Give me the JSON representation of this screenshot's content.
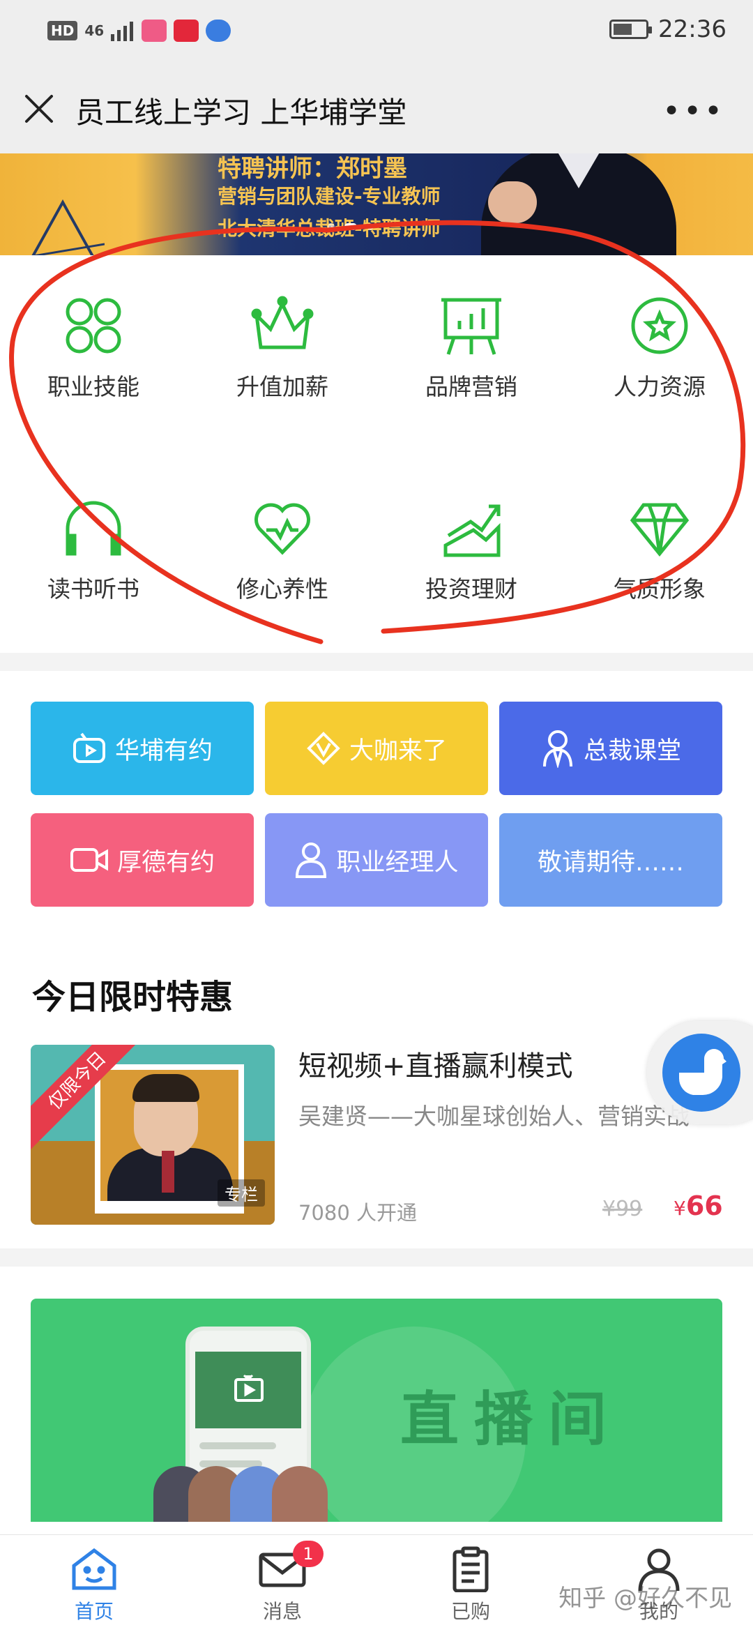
{
  "status_bar": {
    "hd": "HD",
    "signal": "46",
    "time": "22:36"
  },
  "title_bar": {
    "title": "员工线上学习 上华埔学堂",
    "more": "•••"
  },
  "banner": {
    "line1": "特聘讲师：郑时墨",
    "line2": "营销与团队建设-专业教师",
    "line3": "北大清华总裁班-特聘讲师"
  },
  "categories": [
    {
      "label": "职业技能",
      "icon": "clover-icon"
    },
    {
      "label": "升值加薪",
      "icon": "crown-icon"
    },
    {
      "label": "品牌营销",
      "icon": "billboard-chart-icon"
    },
    {
      "label": "人力资源",
      "icon": "star-circle-icon"
    },
    {
      "label": "读书听书",
      "icon": "headphones-icon"
    },
    {
      "label": "修心养性",
      "icon": "heart-pulse-icon"
    },
    {
      "label": "投资理财",
      "icon": "trend-chart-icon"
    },
    {
      "label": "气质形象",
      "icon": "diamond-icon"
    }
  ],
  "sections": [
    {
      "label": "华埔有约",
      "icon": "tv-play-icon",
      "color": "#2bb6ea"
    },
    {
      "label": "大咖来了",
      "icon": "v-badge-icon",
      "color": "#f6cc32"
    },
    {
      "label": "总裁课堂",
      "icon": "person-icon",
      "color": "#4b6ae8"
    },
    {
      "label": "厚德有约",
      "icon": "video-camera-icon",
      "color": "#f5607e"
    },
    {
      "label": "职业经理人",
      "icon": "user-icon",
      "color": "#8797f5"
    },
    {
      "label": "敬请期待……",
      "icon": "",
      "color": "#6f9ef0"
    }
  ],
  "deals": {
    "heading": "今日限时特惠",
    "item": {
      "ribbon": "仅限今日",
      "tag": "专栏",
      "title": "短视频+直播赢利模式",
      "desc": "吴建贤——大咖星球创始人、营销实战",
      "count": "7080 人开通",
      "old_price": "¥99",
      "currency": "¥",
      "price": "66"
    }
  },
  "live": {
    "text": "直播间"
  },
  "tabs": [
    {
      "label": "首页",
      "icon": "home-icon",
      "active": true
    },
    {
      "label": "消息",
      "icon": "mail-icon",
      "badge": "1"
    },
    {
      "label": "已购",
      "icon": "clipboard-icon"
    },
    {
      "label": "我的",
      "icon": "profile-icon"
    }
  ],
  "watermark": "知乎 @好久不见",
  "colors": {
    "accent_blue": "#2f82e6",
    "category_green": "#2dbb3f",
    "price_red": "#e3334f",
    "annotation_red": "#e8321f"
  }
}
